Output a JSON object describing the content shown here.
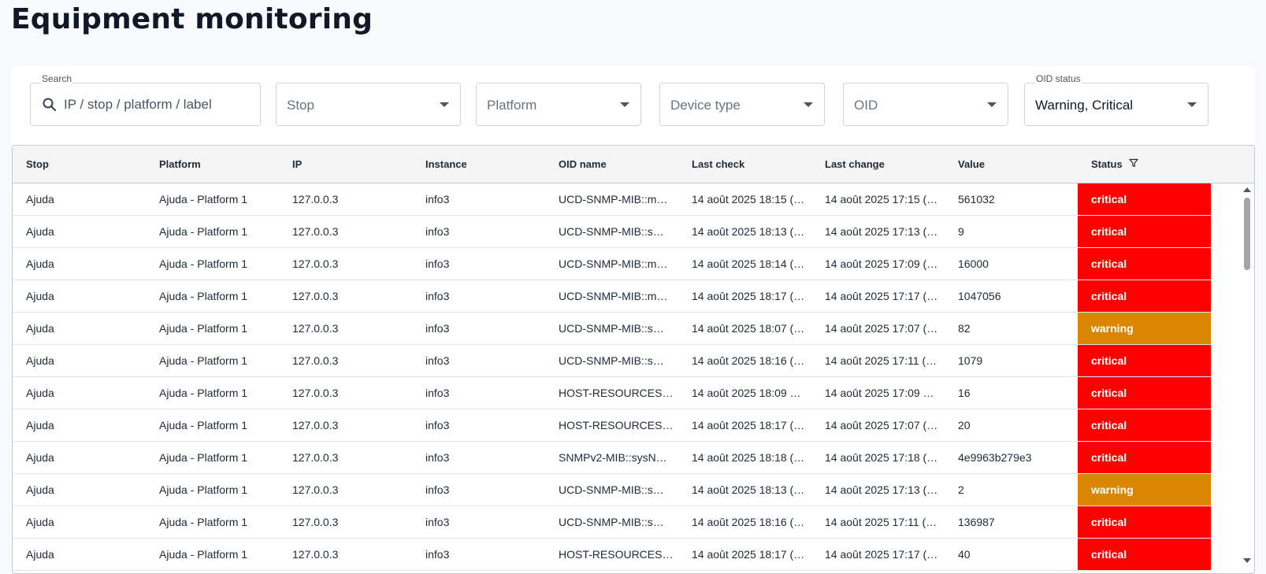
{
  "page": {
    "title": "Equipment monitoring"
  },
  "filters": {
    "search": {
      "label": "Search",
      "placeholder": "IP / stop / platform / label",
      "value": ""
    },
    "stop": {
      "placeholder": "Stop"
    },
    "platform": {
      "placeholder": "Platform"
    },
    "device_type": {
      "placeholder": "Device type"
    },
    "oid": {
      "placeholder": "OID"
    },
    "oid_status": {
      "label": "OID status",
      "value": "Warning, Critical"
    }
  },
  "table": {
    "columns": [
      "Stop",
      "Platform",
      "IP",
      "Instance",
      "OID name",
      "Last check",
      "Last change",
      "Value",
      "Status"
    ],
    "rows": [
      {
        "stop": "Ajuda",
        "platform": "Ajuda - Platform 1",
        "ip": "127.0.0.3",
        "instance": "info3",
        "oid_name": "UCD-SNMP-MIB::m…",
        "last_check": "14 août 2025 18:15 (…",
        "last_change": "14 août 2025 17:15 (…",
        "value": "561032",
        "status": "critical"
      },
      {
        "stop": "Ajuda",
        "platform": "Ajuda - Platform 1",
        "ip": "127.0.0.3",
        "instance": "info3",
        "oid_name": "UCD-SNMP-MIB::s…",
        "last_check": "14 août 2025 18:13 (…",
        "last_change": "14 août 2025 17:13 (…",
        "value": "9",
        "status": "critical"
      },
      {
        "stop": "Ajuda",
        "platform": "Ajuda - Platform 1",
        "ip": "127.0.0.3",
        "instance": "info3",
        "oid_name": "UCD-SNMP-MIB::m…",
        "last_check": "14 août 2025 18:14 (…",
        "last_change": "14 août 2025 17:09 (…",
        "value": "16000",
        "status": "critical"
      },
      {
        "stop": "Ajuda",
        "platform": "Ajuda - Platform 1",
        "ip": "127.0.0.3",
        "instance": "info3",
        "oid_name": "UCD-SNMP-MIB::m…",
        "last_check": "14 août 2025 18:17 (…",
        "last_change": "14 août 2025 17:17 (…",
        "value": "1047056",
        "status": "critical"
      },
      {
        "stop": "Ajuda",
        "platform": "Ajuda - Platform 1",
        "ip": "127.0.0.3",
        "instance": "info3",
        "oid_name": "UCD-SNMP-MIB::s…",
        "last_check": "14 août 2025 18:07 (…",
        "last_change": "14 août 2025 17:07 (…",
        "value": "82",
        "status": "warning"
      },
      {
        "stop": "Ajuda",
        "platform": "Ajuda - Platform 1",
        "ip": "127.0.0.3",
        "instance": "info3",
        "oid_name": "UCD-SNMP-MIB::s…",
        "last_check": "14 août 2025 18:16 (…",
        "last_change": "14 août 2025 17:11 (…",
        "value": "1079",
        "status": "critical"
      },
      {
        "stop": "Ajuda",
        "platform": "Ajuda - Platform 1",
        "ip": "127.0.0.3",
        "instance": "info3",
        "oid_name": "HOST-RESOURCES…",
        "last_check": "14 août 2025 18:09 …",
        "last_change": "14 août 2025 17:09 …",
        "value": "16",
        "status": "critical"
      },
      {
        "stop": "Ajuda",
        "platform": "Ajuda - Platform 1",
        "ip": "127.0.0.3",
        "instance": "info3",
        "oid_name": "HOST-RESOURCES…",
        "last_check": "14 août 2025 18:17 (…",
        "last_change": "14 août 2025 17:07 (…",
        "value": "20",
        "status": "critical"
      },
      {
        "stop": "Ajuda",
        "platform": "Ajuda - Platform 1",
        "ip": "127.0.0.3",
        "instance": "info3",
        "oid_name": "SNMPv2-MIB::sysN…",
        "last_check": "14 août 2025 18:18 (…",
        "last_change": "14 août 2025 17:18 (…",
        "value": "4e9963b279e3",
        "status": "critical"
      },
      {
        "stop": "Ajuda",
        "platform": "Ajuda - Platform 1",
        "ip": "127.0.0.3",
        "instance": "info3",
        "oid_name": "UCD-SNMP-MIB::s…",
        "last_check": "14 août 2025 18:13 (…",
        "last_change": "14 août 2025 17:13 (…",
        "value": "2",
        "status": "warning"
      },
      {
        "stop": "Ajuda",
        "platform": "Ajuda - Platform 1",
        "ip": "127.0.0.3",
        "instance": "info3",
        "oid_name": "UCD-SNMP-MIB::s…",
        "last_check": "14 août 2025 18:16 (…",
        "last_change": "14 août 2025 17:11 (…",
        "value": "136987",
        "status": "critical"
      },
      {
        "stop": "Ajuda",
        "platform": "Ajuda - Platform 1",
        "ip": "127.0.0.3",
        "instance": "info3",
        "oid_name": "HOST-RESOURCES…",
        "last_check": "14 août 2025 18:17 (…",
        "last_change": "14 août 2025 17:17 (…",
        "value": "40",
        "status": "critical"
      }
    ]
  },
  "colors": {
    "critical": "#fe0000",
    "warning": "#d98700",
    "status_text": "#ffffff"
  },
  "icons": {
    "search": "search-icon",
    "dropdown": "chevron-down-icon",
    "filter": "filter-icon"
  }
}
